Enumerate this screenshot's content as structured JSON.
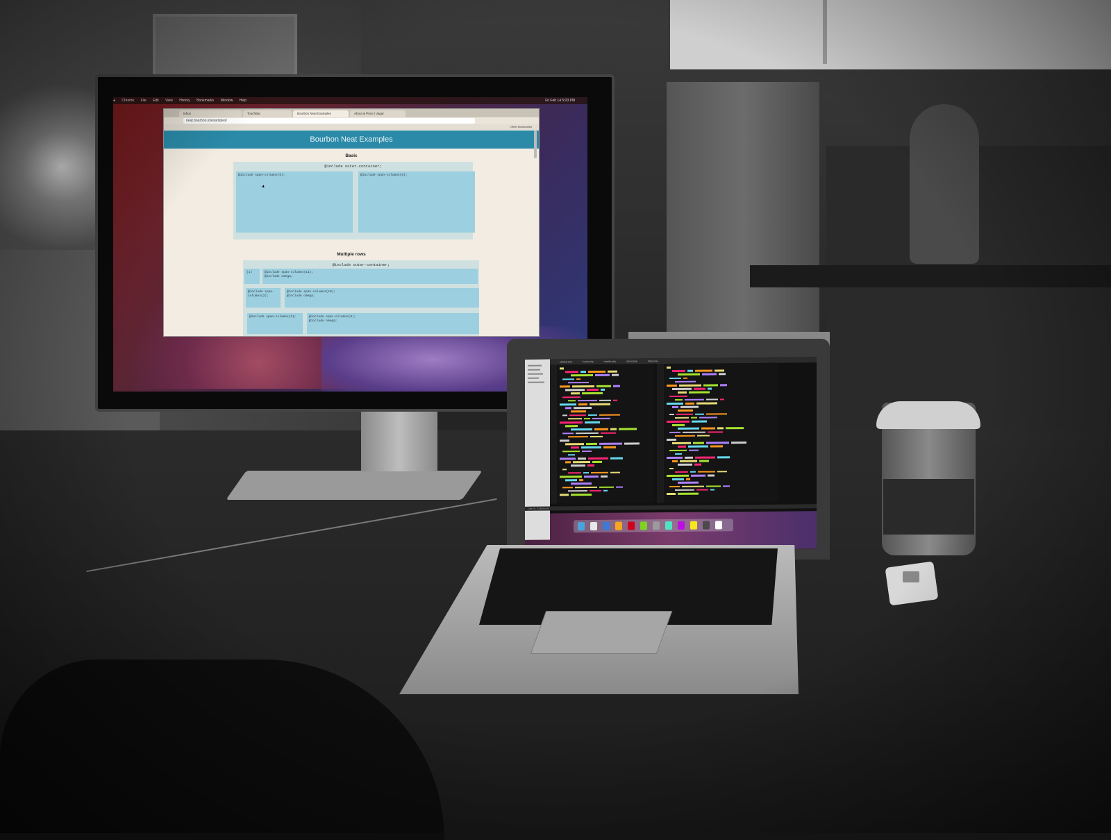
{
  "menubar": {
    "items": [
      "Chrome",
      "File",
      "Edit",
      "View",
      "History",
      "Bookmarks",
      "Window",
      "Help"
    ],
    "clock": "Fri Feb 14 5:03 PM"
  },
  "browser": {
    "tabs": [
      "Inbox",
      "TouchBar",
      "Bourbon Neat Examples",
      "About & Price | Vagar"
    ],
    "url": "neat.bourbon.io/examples/",
    "bookmark_right": "Other Bookmarks"
  },
  "page": {
    "header": "Bourbon Neat Examples",
    "basic": {
      "title": "Basic",
      "outer_label": "@include outer-container;",
      "col1": "@include span-columns(6);",
      "col2": "@include span-columns(6);"
    },
    "multiple_rows": {
      "title": "Multiple rows",
      "outer_label": "@include outer-container;",
      "r1c1": "(1)",
      "r1c2": "@include span-columns(11);\n@include omega;",
      "r2c1": "@include span-\ncolumns(2);",
      "r2c2": "@include span-columns(10);\n@include omega;",
      "r3c1": "@include span-columns(3);",
      "r3c2": "@include span-columns(9);\n@include omega;"
    }
  },
  "laptop": {
    "editor_tabs": [
      "sidebar.php",
      "footer.php",
      "header.php",
      "about.php",
      "style.scss"
    ],
    "status_bar": "Line 31, Column 46"
  },
  "colors": {
    "neat_header": "#2a8aa8",
    "column_blue": "#9ccfdf"
  }
}
